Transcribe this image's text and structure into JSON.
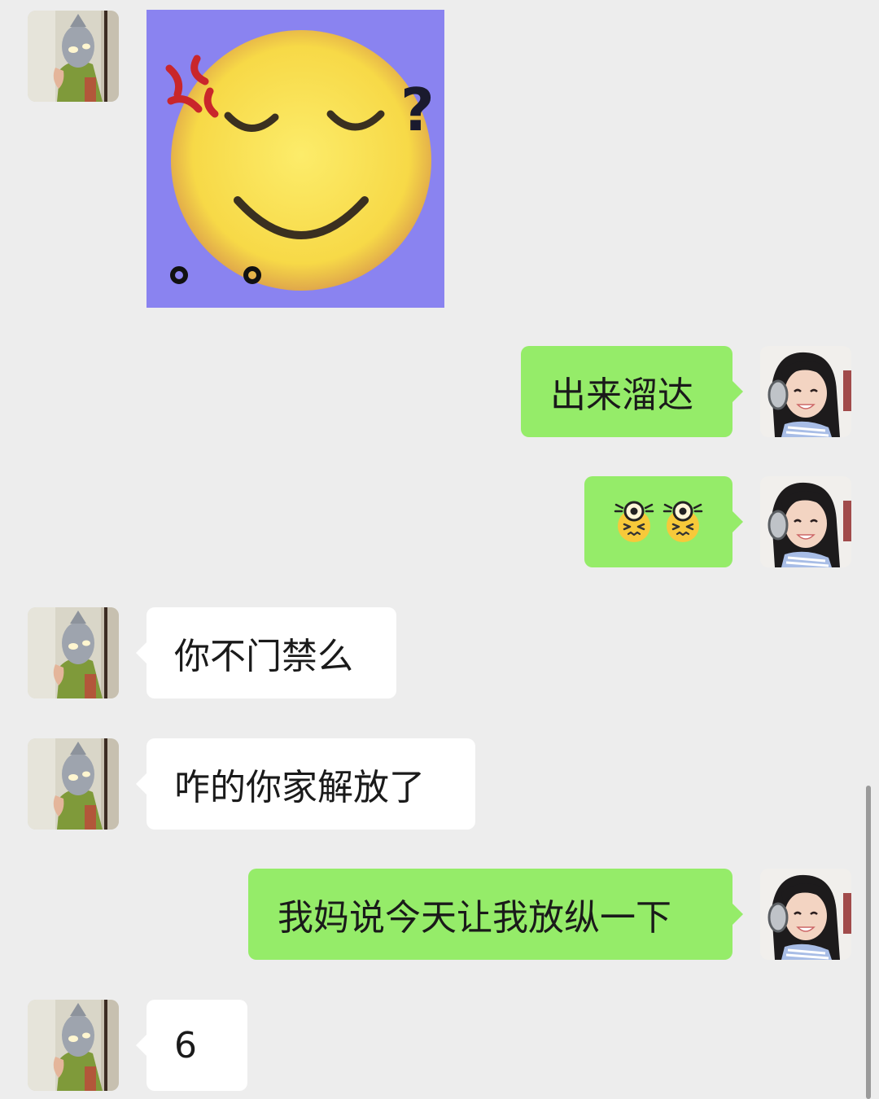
{
  "chat": {
    "messages": [
      {
        "sender": "contact",
        "type": "sticker",
        "sticker": "annoyed-smiling-face-sticker"
      },
      {
        "sender": "me",
        "type": "text",
        "text": "出来溜达"
      },
      {
        "sender": "me",
        "type": "emoji",
        "emoji": "squinting-laughing-face-with-eyes-icon"
      },
      {
        "sender": "contact",
        "type": "text",
        "text": "你不门禁么"
      },
      {
        "sender": "contact",
        "type": "text",
        "text": "咋的你家解放了"
      },
      {
        "sender": "me",
        "type": "text",
        "text": "我妈说今天让我放纵一下"
      },
      {
        "sender": "contact",
        "type": "text",
        "text": "6"
      }
    ]
  },
  "theme": {
    "background": "#ededed",
    "incoming_bubble": "#ffffff",
    "outgoing_bubble": "#95ec69",
    "sticker_background": "#8a83f0"
  }
}
